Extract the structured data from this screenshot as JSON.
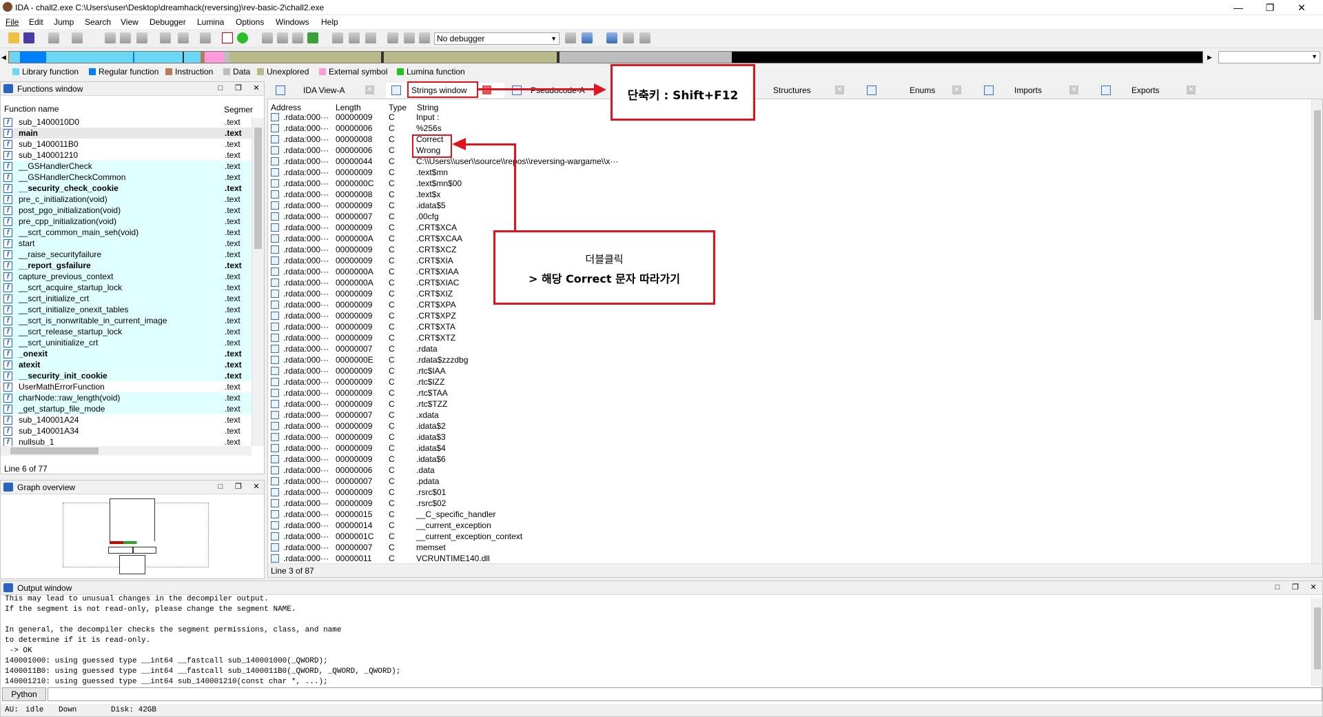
{
  "window": {
    "title": "IDA - chall2.exe C:\\Users\\user\\Desktop\\dreamhack(reversing)\\rev-basic-2\\chall2.exe",
    "min_glyph": "—",
    "restore_glyph": "❐",
    "close_glyph": "✕"
  },
  "menu": [
    "File",
    "Edit",
    "Jump",
    "Search",
    "View",
    "Debugger",
    "Lumina",
    "Options",
    "Windows",
    "Help"
  ],
  "toolbar": {
    "debugger_select": "No debugger"
  },
  "legend": [
    {
      "label": "Library function",
      "color": "#6cd6f5"
    },
    {
      "label": "Regular function",
      "color": "#0080ff"
    },
    {
      "label": "Instruction",
      "color": "#b47c5a"
    },
    {
      "label": "Data",
      "color": "#bdbdbd"
    },
    {
      "label": "Unexplored",
      "color": "#b9b98a"
    },
    {
      "label": "External symbol",
      "color": "#ff9bd9"
    },
    {
      "label": "Lumina function",
      "color": "#22c322"
    }
  ],
  "functions": {
    "title": "Functions window",
    "col_name": "Function name",
    "col_segment": "Segmer",
    "status": "Line 6 of 77",
    "rows": [
      {
        "name": "sub_1400010D0",
        "seg": ".text",
        "lib": false,
        "bold": false
      },
      {
        "name": "main",
        "seg": ".text",
        "lib": false,
        "bold": true
      },
      {
        "name": "sub_1400011B0",
        "seg": ".text",
        "lib": false,
        "bold": false
      },
      {
        "name": "sub_140001210",
        "seg": ".text",
        "lib": false,
        "bold": false
      },
      {
        "name": "__GSHandlerCheck",
        "seg": ".text",
        "lib": true,
        "bold": false
      },
      {
        "name": "__GSHandlerCheckCommon",
        "seg": ".text",
        "lib": true,
        "bold": false
      },
      {
        "name": "__security_check_cookie",
        "seg": ".text",
        "lib": true,
        "bold": true
      },
      {
        "name": "pre_c_initialization(void)",
        "seg": ".text",
        "lib": true,
        "bold": false
      },
      {
        "name": "post_pgo_initialization(void)",
        "seg": ".text",
        "lib": true,
        "bold": false
      },
      {
        "name": "pre_cpp_initialization(void)",
        "seg": ".text",
        "lib": true,
        "bold": false
      },
      {
        "name": "__scrt_common_main_seh(void)",
        "seg": ".text",
        "lib": true,
        "bold": false
      },
      {
        "name": "start",
        "seg": ".text",
        "lib": true,
        "bold": false
      },
      {
        "name": "__raise_securityfailure",
        "seg": ".text",
        "lib": true,
        "bold": false
      },
      {
        "name": "__report_gsfailure",
        "seg": ".text",
        "lib": true,
        "bold": true
      },
      {
        "name": "capture_previous_context",
        "seg": ".text",
        "lib": true,
        "bold": false
      },
      {
        "name": "__scrt_acquire_startup_lock",
        "seg": ".text",
        "lib": true,
        "bold": false
      },
      {
        "name": "__scrt_initialize_crt",
        "seg": ".text",
        "lib": true,
        "bold": false
      },
      {
        "name": "__scrt_initialize_onexit_tables",
        "seg": ".text",
        "lib": true,
        "bold": false
      },
      {
        "name": "__scrt_is_nonwritable_in_current_image",
        "seg": ".text",
        "lib": true,
        "bold": false
      },
      {
        "name": "__scrt_release_startup_lock",
        "seg": ".text",
        "lib": true,
        "bold": false
      },
      {
        "name": "__scrt_uninitialize_crt",
        "seg": ".text",
        "lib": true,
        "bold": false
      },
      {
        "name": "_onexit",
        "seg": ".text",
        "lib": true,
        "bold": true
      },
      {
        "name": "atexit",
        "seg": ".text",
        "lib": true,
        "bold": true
      },
      {
        "name": "__security_init_cookie",
        "seg": ".text",
        "lib": true,
        "bold": true
      },
      {
        "name": "UserMathErrorFunction",
        "seg": ".text",
        "lib": false,
        "bold": false
      },
      {
        "name": "charNode::raw_length(void)",
        "seg": ".text",
        "lib": true,
        "bold": false
      },
      {
        "name": "_get_startup_file_mode",
        "seg": ".text",
        "lib": true,
        "bold": false
      },
      {
        "name": "sub_140001A24",
        "seg": ".text",
        "lib": false,
        "bold": false
      },
      {
        "name": "sub_140001A34",
        "seg": ".text",
        "lib": false,
        "bold": false
      },
      {
        "name": "nullsub_1",
        "seg": ".text",
        "lib": false,
        "bold": false
      }
    ]
  },
  "graph": {
    "title": "Graph overview"
  },
  "tabs": [
    {
      "label": "IDA View-A"
    },
    {
      "label": "Strings window"
    },
    {
      "label": "Pseudocode-A"
    },
    {
      "label": "Structures"
    },
    {
      "label": "Enums"
    },
    {
      "label": "Imports"
    },
    {
      "label": "Exports"
    }
  ],
  "strings": {
    "col_address": "Address",
    "col_length": "Length",
    "col_type": "Type",
    "col_string": "String",
    "status": "Line 3 of 87",
    "rows": [
      {
        "a": ".rdata:000···",
        "l": "00000009",
        "t": "C",
        "s": "Input : "
      },
      {
        "a": ".rdata:000···",
        "l": "00000006",
        "t": "C",
        "s": "%256s"
      },
      {
        "a": ".rdata:000···",
        "l": "00000008",
        "t": "C",
        "s": "Correct"
      },
      {
        "a": ".rdata:000···",
        "l": "00000006",
        "t": "C",
        "s": "Wrong"
      },
      {
        "a": ".rdata:000···",
        "l": "00000044",
        "t": "C",
        "s": "C:\\\\Users\\\\user\\\\source\\\\repos\\\\reversing-wargame\\\\x···"
      },
      {
        "a": ".rdata:000···",
        "l": "00000009",
        "t": "C",
        "s": ".text$mn"
      },
      {
        "a": ".rdata:000···",
        "l": "0000000C",
        "t": "C",
        "s": ".text$mn$00"
      },
      {
        "a": ".rdata:000···",
        "l": "00000008",
        "t": "C",
        "s": ".text$x"
      },
      {
        "a": ".rdata:000···",
        "l": "00000009",
        "t": "C",
        "s": ".idata$5"
      },
      {
        "a": ".rdata:000···",
        "l": "00000007",
        "t": "C",
        "s": ".00cfg"
      },
      {
        "a": ".rdata:000···",
        "l": "00000009",
        "t": "C",
        "s": ".CRT$XCA"
      },
      {
        "a": ".rdata:000···",
        "l": "0000000A",
        "t": "C",
        "s": ".CRT$XCAA"
      },
      {
        "a": ".rdata:000···",
        "l": "00000009",
        "t": "C",
        "s": ".CRT$XCZ"
      },
      {
        "a": ".rdata:000···",
        "l": "00000009",
        "t": "C",
        "s": ".CRT$XIA"
      },
      {
        "a": ".rdata:000···",
        "l": "0000000A",
        "t": "C",
        "s": ".CRT$XIAA"
      },
      {
        "a": ".rdata:000···",
        "l": "0000000A",
        "t": "C",
        "s": ".CRT$XIAC"
      },
      {
        "a": ".rdata:000···",
        "l": "00000009",
        "t": "C",
        "s": ".CRT$XIZ"
      },
      {
        "a": ".rdata:000···",
        "l": "00000009",
        "t": "C",
        "s": ".CRT$XPA"
      },
      {
        "a": ".rdata:000···",
        "l": "00000009",
        "t": "C",
        "s": ".CRT$XPZ"
      },
      {
        "a": ".rdata:000···",
        "l": "00000009",
        "t": "C",
        "s": ".CRT$XTA"
      },
      {
        "a": ".rdata:000···",
        "l": "00000009",
        "t": "C",
        "s": ".CRT$XTZ"
      },
      {
        "a": ".rdata:000···",
        "l": "00000007",
        "t": "C",
        "s": ".rdata"
      },
      {
        "a": ".rdata:000···",
        "l": "0000000E",
        "t": "C",
        "s": ".rdata$zzzdbg"
      },
      {
        "a": ".rdata:000···",
        "l": "00000009",
        "t": "C",
        "s": ".rtc$IAA"
      },
      {
        "a": ".rdata:000···",
        "l": "00000009",
        "t": "C",
        "s": ".rtc$IZZ"
      },
      {
        "a": ".rdata:000···",
        "l": "00000009",
        "t": "C",
        "s": ".rtc$TAA"
      },
      {
        "a": ".rdata:000···",
        "l": "00000009",
        "t": "C",
        "s": ".rtc$TZZ"
      },
      {
        "a": ".rdata:000···",
        "l": "00000007",
        "t": "C",
        "s": ".xdata"
      },
      {
        "a": ".rdata:000···",
        "l": "00000009",
        "t": "C",
        "s": ".idata$2"
      },
      {
        "a": ".rdata:000···",
        "l": "00000009",
        "t": "C",
        "s": ".idata$3"
      },
      {
        "a": ".rdata:000···",
        "l": "00000009",
        "t": "C",
        "s": ".idata$4"
      },
      {
        "a": ".rdata:000···",
        "l": "00000009",
        "t": "C",
        "s": ".idata$6"
      },
      {
        "a": ".rdata:000···",
        "l": "00000006",
        "t": "C",
        "s": ".data"
      },
      {
        "a": ".rdata:000···",
        "l": "00000007",
        "t": "C",
        "s": ".pdata"
      },
      {
        "a": ".rdata:000···",
        "l": "00000009",
        "t": "C",
        "s": ".rsrc$01"
      },
      {
        "a": ".rdata:000···",
        "l": "00000009",
        "t": "C",
        "s": ".rsrc$02"
      },
      {
        "a": ".rdata:000···",
        "l": "00000015",
        "t": "C",
        "s": "__C_specific_handler"
      },
      {
        "a": ".rdata:000···",
        "l": "00000014",
        "t": "C",
        "s": "__current_exception"
      },
      {
        "a": ".rdata:000···",
        "l": "0000001C",
        "t": "C",
        "s": "__current_exception_context"
      },
      {
        "a": ".rdata:000···",
        "l": "00000007",
        "t": "C",
        "s": "memset"
      },
      {
        "a": ".rdata:000···",
        "l": "00000011",
        "t": "C",
        "s": "VCRUNTIME140.dll"
      }
    ]
  },
  "output": {
    "title": "Output window",
    "lines": [
      "This may lead to unusual changes in the decompiler output.",
      "If the segment is not read-only, please change the segment NAME.",
      "",
      "In general, the decompiler checks the segment permissions, class, and name",
      "to determine if it is read-only.",
      " -> OK",
      "140001000: using guessed type __int64 __fastcall sub_140001000(_QWORD);",
      "1400011B0: using guessed type __int64 __fastcall sub_1400011B0(_QWORD, _QWORD, _QWORD);",
      "140001210: using guessed type __int64 sub_140001210(const char *, ...);"
    ],
    "python_button": "Python"
  },
  "statusbar": {
    "au": "AU:",
    "au_state": "idle",
    "direction": "Down",
    "disk": "Disk: 42GB"
  },
  "annotations": {
    "shortcut": "단축키 : Shift+F12",
    "dblclick_line1": "더블클릭",
    "dblclick_line2": "> 해당 Correct 문자 따라가기"
  },
  "colors": {
    "accent_red": "#e0141e",
    "lib_bg": "#e0ffff",
    "regular_blue": "#0080ff"
  }
}
